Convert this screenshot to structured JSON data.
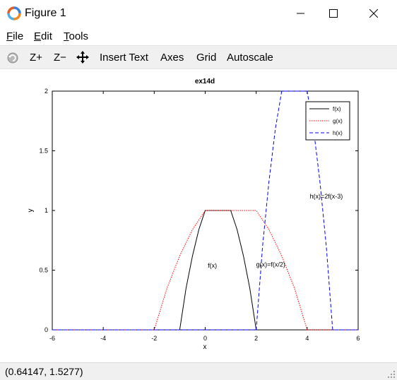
{
  "window": {
    "title": "Figure 1"
  },
  "menu": {
    "file": {
      "accel": "F",
      "rest": "ile"
    },
    "edit": {
      "accel": "E",
      "rest": "dit"
    },
    "tools": {
      "accel": "T",
      "rest": "ools"
    }
  },
  "toolbar": {
    "zoom_in": "Z+",
    "zoom_out": "Z−",
    "insert_text": "Insert Text",
    "axes": "Axes",
    "grid": "Grid",
    "autoscale": "Autoscale"
  },
  "icons": [
    "octave-logo-icon",
    "minimize-icon",
    "maximize-icon",
    "close-icon",
    "rotate-icon",
    "pan-icon",
    "resize-grip-icon"
  ],
  "status": {
    "coords": "(0.64147, 1.5277)"
  },
  "chart_data": {
    "type": "line",
    "title": "ex14d",
    "xlabel": "x",
    "ylabel": "y",
    "xlim": [
      -6,
      6
    ],
    "ylim": [
      0,
      2
    ],
    "xticks": [
      "-6",
      "-4",
      "-2",
      "0",
      "2",
      "4",
      "6"
    ],
    "yticks": [
      "0",
      "0.5",
      "1",
      "1.5",
      "2"
    ],
    "grid": false,
    "legend_position": "top-right",
    "series": [
      {
        "name": "f(x)",
        "color": "#000000",
        "dash": "solid",
        "x": [
          -6,
          -1,
          -0.75,
          -0.5,
          -0.25,
          0,
          1,
          1.25,
          1.5,
          1.75,
          2,
          6
        ],
        "y": [
          0,
          0,
          0.35,
          0.62,
          0.84,
          1,
          1,
          0.84,
          0.62,
          0.35,
          0,
          0
        ]
      },
      {
        "name": "g(x)",
        "color": "#ff0000",
        "dash": "dotted",
        "x": [
          -6,
          -2,
          -1.5,
          -1,
          -0.5,
          0,
          2,
          2.5,
          3,
          3.5,
          4,
          6
        ],
        "y": [
          0,
          0,
          0.35,
          0.62,
          0.84,
          1,
          1,
          0.84,
          0.62,
          0.35,
          0,
          0
        ]
      },
      {
        "name": "h(x)",
        "color": "#0000ff",
        "dash": "dashed",
        "x": [
          -6,
          2,
          2.25,
          2.5,
          2.75,
          3,
          4,
          4.25,
          4.5,
          4.75,
          5,
          6
        ],
        "y": [
          0,
          0,
          0.7,
          1.24,
          1.68,
          2,
          2,
          1.68,
          1.24,
          0.7,
          0,
          0
        ]
      }
    ],
    "annotations": [
      {
        "text": "f(x)",
        "x": 0.1,
        "y": 0.52
      },
      {
        "text": "g(x)=f(x/2)",
        "x": 2.0,
        "y": 0.53
      },
      {
        "text": "h(x)=2f(x-3)",
        "x": 4.1,
        "y": 1.1
      }
    ]
  }
}
